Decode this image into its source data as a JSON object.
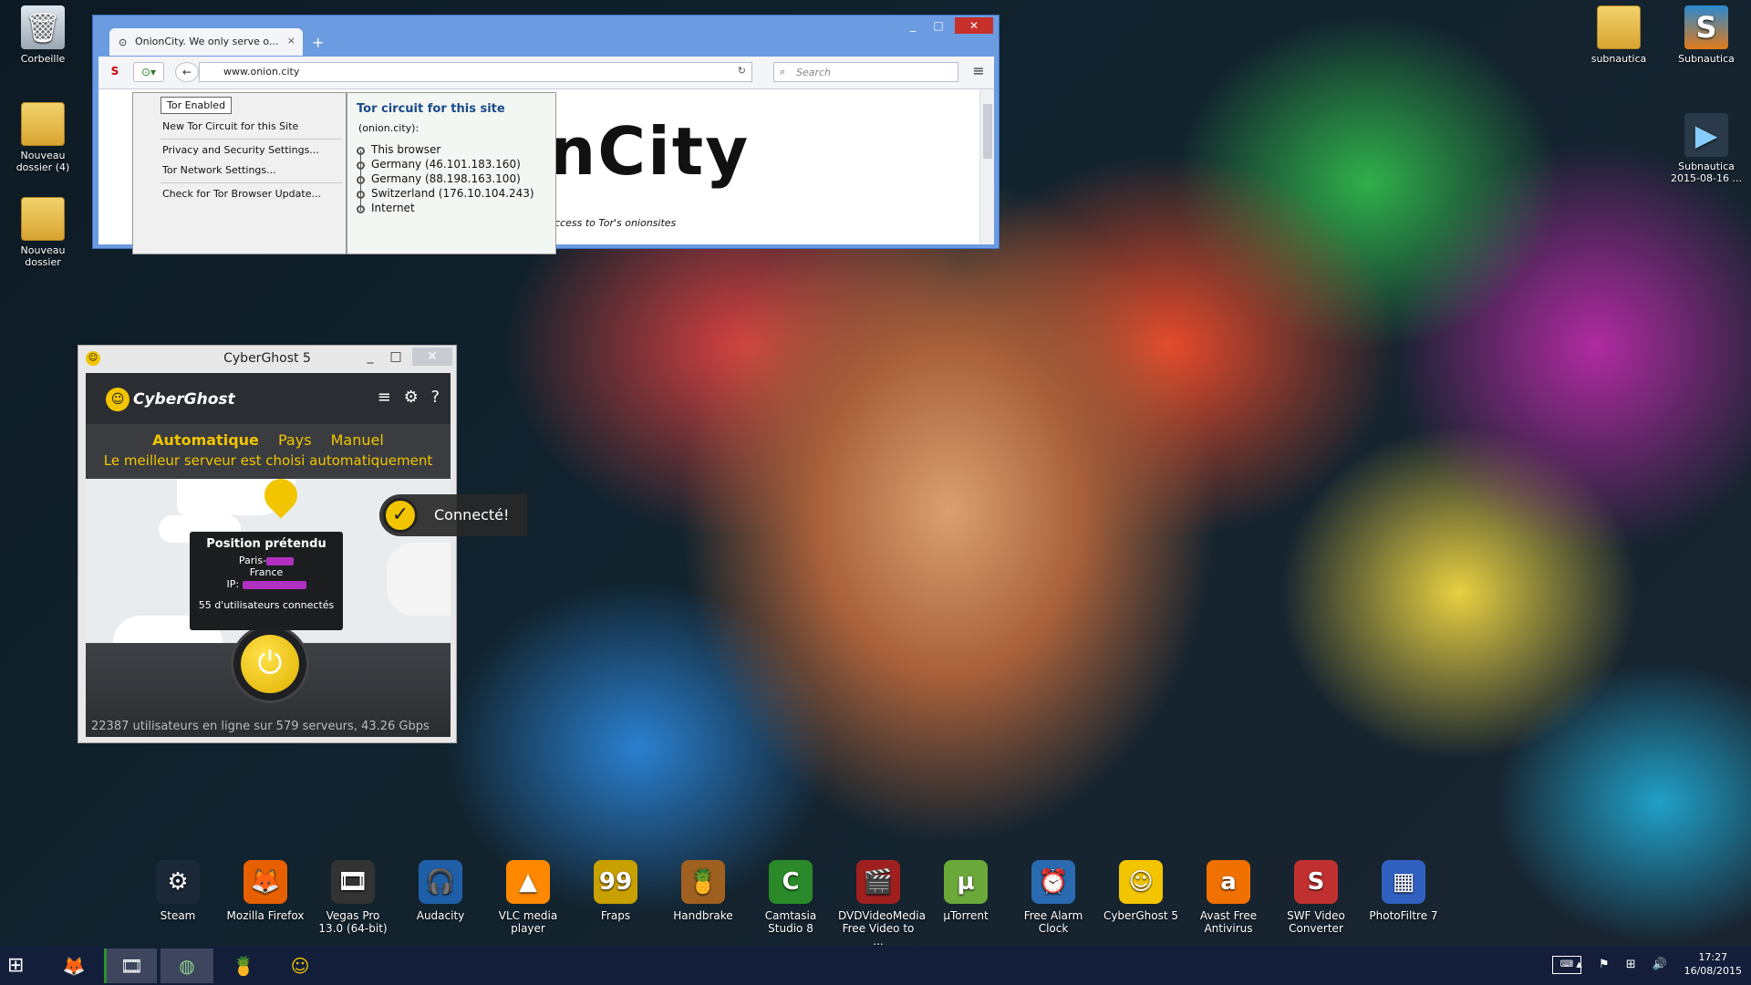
{
  "desktop": {
    "icons_left": [
      {
        "label": "Corbeille",
        "icon": "recycle-bin-icon"
      },
      {
        "label": "Nouveau dossier (4)",
        "icon": "folder-icon"
      },
      {
        "label": "Nouveau dossier",
        "icon": "folder-icon"
      }
    ],
    "icons_right": [
      {
        "label": "subnautica",
        "icon": "folder-icon"
      },
      {
        "label": "Subnautica",
        "icon": "subnautica-icon"
      },
      {
        "label": "Subnautica 2015-08-16 ...",
        "icon": "video-file-icon"
      }
    ],
    "shortcuts": [
      {
        "label": "Steam",
        "glyph": "⚙",
        "color": "#1b2838"
      },
      {
        "label": "Mozilla Firefox",
        "glyph": "🦊",
        "color": "#e66000"
      },
      {
        "label": "Vegas Pro 13.0 (64-bit)",
        "glyph": "🎞",
        "color": "#333"
      },
      {
        "label": "Audacity",
        "glyph": "🎧",
        "color": "#1f5fa8"
      },
      {
        "label": "VLC media player",
        "glyph": "▲",
        "color": "#ff8800"
      },
      {
        "label": "Fraps",
        "glyph": "99",
        "color": "#c8a000"
      },
      {
        "label": "Handbrake",
        "glyph": "🍍",
        "color": "#a06020"
      },
      {
        "label": "Camtasia Studio 8",
        "glyph": "C",
        "color": "#2a8a2a"
      },
      {
        "label": "DVDVideoMedia Free Video to ...",
        "glyph": "🎬",
        "color": "#a02020"
      },
      {
        "label": "µTorrent",
        "glyph": "µ",
        "color": "#6aa83a"
      },
      {
        "label": "Free Alarm Clock",
        "glyph": "⏰",
        "color": "#2a6ab0"
      },
      {
        "label": "CyberGhost 5",
        "glyph": "☺",
        "color": "#f2c500"
      },
      {
        "label": "Avast Free Antivirus",
        "glyph": "a",
        "color": "#f07000"
      },
      {
        "label": "SWF Video Converter",
        "glyph": "S",
        "color": "#c03030"
      },
      {
        "label": "PhotoFiltre 7",
        "glyph": "▦",
        "color": "#3060c0"
      }
    ]
  },
  "browser": {
    "tab_title": "OnionCity. We only serve o...",
    "url": "www.onion.city",
    "search_placeholder": "Search",
    "page_logo": "nCity",
    "page_tagline": "ccess to Tor's onionsites",
    "tor_menu": [
      "Tor Enabled",
      "New Tor Circuit for this Site",
      "Privacy and Security Settings...",
      "Tor Network Settings...",
      "Check for Tor Browser Update..."
    ],
    "circuit": {
      "title": "Tor circuit for this site",
      "site": "(onion.city):",
      "hops": [
        "This browser",
        "Germany (46.101.183.160)",
        "Germany (88.198.163.100)",
        "Switzerland (176.10.104.243)",
        "Internet"
      ]
    }
  },
  "cyberghost": {
    "window_title": "CyberGhost 5",
    "brand": "CyberGhost",
    "modes": [
      "Automatique",
      "Pays",
      "Manuel"
    ],
    "active_mode": "Automatique",
    "mode_description": "Le meilleur serveur est choisi automatiquement",
    "connected_label": "Connecté!",
    "popup": {
      "title": "Position prétendu",
      "city": "Paris-",
      "country": "France",
      "ip_label": "IP:",
      "users": "55 d'utilisateurs connectés"
    },
    "status": "22387 utilisateurs en ligne sur 579 serveurs, 43.26 Gbps",
    "accent": "#f2c500"
  },
  "taskbar": {
    "items": [
      "firefox-icon",
      "vegas-icon",
      "tor-globe-icon",
      "handbrake-icon",
      "cyberghost-icon"
    ],
    "time": "17:27",
    "date": "16/08/2015"
  }
}
